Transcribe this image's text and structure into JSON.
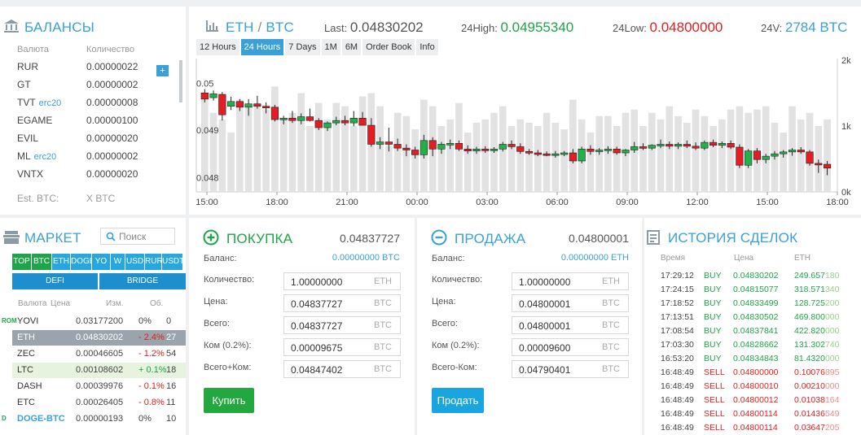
{
  "balances": {
    "title": "БАЛАНСЫ",
    "col_currency": "Валюта",
    "col_amount": "Количество",
    "add_label": "+",
    "rows": [
      {
        "cur": "RUR",
        "tag": "",
        "amt": "0.00000022"
      },
      {
        "cur": "GT",
        "tag": "",
        "amt": "0.00000002"
      },
      {
        "cur": "TVT",
        "tag": "erc20",
        "amt": "0.00000008"
      },
      {
        "cur": "EGAME",
        "tag": "",
        "amt": "0.00000100"
      },
      {
        "cur": "EVIL",
        "tag": "",
        "amt": "0.00000020"
      },
      {
        "cur": "ML",
        "tag": "erc20",
        "amt": "0.00000002"
      },
      {
        "cur": "VNTX",
        "tag": "",
        "amt": "0.00000020"
      }
    ],
    "est_label": "Est. BTC:",
    "est_value": "X BTC"
  },
  "pair": {
    "base": "ETH",
    "sep": " / ",
    "quote": "BTC",
    "last_label": "Last:",
    "last": "0.04830202",
    "high_label": "24High:",
    "high": "0.04955340",
    "low_label": "24Low:",
    "low": "0.04800000",
    "vol_label": "24V:",
    "vol": "2784 BTC"
  },
  "chart_tabs": [
    "12 Hours",
    "24 Hours",
    "7 Days",
    "1M",
    "6M",
    "Order Book",
    "Info"
  ],
  "chart_tab_active": 1,
  "colors": {
    "accent": "#3aa0d8",
    "up": "#1fa44a",
    "down": "#e02020",
    "candle_up": "#22b04b",
    "candle_down": "#e41c24"
  },
  "chart_data": {
    "type": "candlestick",
    "y_ticks": [
      "0.05",
      "0.049",
      "0.048"
    ],
    "y2_ticks": [
      "2k",
      "1k",
      "0k"
    ],
    "x_ticks": [
      "15:00",
      "18:00",
      "21:00",
      "00:00",
      "03:00",
      "06:00",
      "09:00",
      "12:00",
      "15:00",
      "18:00"
    ],
    "ylim": [
      0.0478,
      0.0505
    ],
    "y2lim": [
      0,
      2000
    ],
    "ohlc": [
      [
        0.04988,
        0.04996,
        0.04968,
        0.04975
      ],
      [
        0.04978,
        0.04993,
        0.04972,
        0.04986
      ],
      [
        0.04985,
        0.0499,
        0.0493,
        0.04942
      ],
      [
        0.0496,
        0.0498,
        0.04952,
        0.0497
      ],
      [
        0.0497,
        0.04975,
        0.0495,
        0.04958
      ],
      [
        0.04958,
        0.04975,
        0.0494,
        0.04965
      ],
      [
        0.04965,
        0.04982,
        0.04955,
        0.0496
      ],
      [
        0.0496,
        0.04968,
        0.04945,
        0.04958
      ],
      [
        0.04958,
        0.04963,
        0.04928,
        0.04932
      ],
      [
        0.04932,
        0.0494,
        0.04922,
        0.04935
      ],
      [
        0.04935,
        0.0495,
        0.04925,
        0.0493
      ],
      [
        0.0493,
        0.04945,
        0.04922,
        0.04938
      ],
      [
        0.04938,
        0.04955,
        0.04928,
        0.0493
      ],
      [
        0.0493,
        0.04935,
        0.0491,
        0.04915
      ],
      [
        0.04915,
        0.04928,
        0.04908,
        0.04925
      ],
      [
        0.04925,
        0.04938,
        0.0492,
        0.0493
      ],
      [
        0.0493,
        0.0494,
        0.0492,
        0.04925
      ],
      [
        0.04925,
        0.0495,
        0.04918,
        0.04935
      ],
      [
        0.04935,
        0.04948,
        0.04925,
        0.0492
      ],
      [
        0.0492,
        0.04935,
        0.04875,
        0.0488
      ],
      [
        0.0488,
        0.04895,
        0.0487,
        0.04885
      ],
      [
        0.04885,
        0.04915,
        0.04865,
        0.0488
      ],
      [
        0.0488,
        0.04892,
        0.04866,
        0.04872
      ],
      [
        0.04872,
        0.0488,
        0.04855,
        0.04868
      ],
      [
        0.04868,
        0.04875,
        0.0485,
        0.04858
      ],
      [
        0.04858,
        0.049,
        0.0485,
        0.04888
      ],
      [
        0.04888,
        0.04895,
        0.04855,
        0.0487
      ],
      [
        0.0487,
        0.04885,
        0.0486,
        0.0488
      ],
      [
        0.0488,
        0.0489,
        0.0487,
        0.04882
      ],
      [
        0.04882,
        0.04888,
        0.04866,
        0.0487
      ],
      [
        0.0487,
        0.04878,
        0.0486,
        0.04866
      ],
      [
        0.04866,
        0.04875,
        0.0486,
        0.0487
      ],
      [
        0.0487,
        0.04876,
        0.04862,
        0.04868
      ],
      [
        0.04868,
        0.04874,
        0.04862,
        0.0487
      ],
      [
        0.0487,
        0.04885,
        0.04865,
        0.0488
      ],
      [
        0.0488,
        0.04888,
        0.0487,
        0.04875
      ],
      [
        0.04875,
        0.04882,
        0.0486,
        0.04865
      ],
      [
        0.04865,
        0.0487,
        0.04858,
        0.04862
      ],
      [
        0.04862,
        0.04868,
        0.04855,
        0.0486
      ],
      [
        0.0486,
        0.04865,
        0.04855,
        0.04858
      ],
      [
        0.04858,
        0.04866,
        0.04852,
        0.0486
      ],
      [
        0.0486,
        0.04866,
        0.04855,
        0.04862
      ],
      [
        0.04862,
        0.0487,
        0.0484,
        0.04845
      ],
      [
        0.04845,
        0.04875,
        0.0484,
        0.0487
      ],
      [
        0.0487,
        0.04878,
        0.04858,
        0.04865
      ],
      [
        0.04865,
        0.04872,
        0.04858,
        0.04868
      ],
      [
        0.04868,
        0.04876,
        0.0486,
        0.0487
      ],
      [
        0.0487,
        0.04875,
        0.04858,
        0.04862
      ],
      [
        0.04862,
        0.0487,
        0.04855,
        0.04868
      ],
      [
        0.04868,
        0.04885,
        0.04862,
        0.04875
      ],
      [
        0.04875,
        0.04882,
        0.04868,
        0.04872
      ],
      [
        0.04872,
        0.0488,
        0.04868,
        0.04878
      ],
      [
        0.04878,
        0.0489,
        0.04872,
        0.0488
      ],
      [
        0.0488,
        0.04886,
        0.0487,
        0.04876
      ],
      [
        0.04876,
        0.04884,
        0.0487,
        0.0488
      ],
      [
        0.0488,
        0.04888,
        0.04872,
        0.04876
      ],
      [
        0.04876,
        0.04884,
        0.04868,
        0.04872
      ],
      [
        0.04872,
        0.04888,
        0.04868,
        0.04884
      ],
      [
        0.04884,
        0.0489,
        0.04874,
        0.04878
      ],
      [
        0.04878,
        0.04886,
        0.04872,
        0.04882
      ],
      [
        0.04882,
        0.04888,
        0.0487,
        0.04874
      ],
      [
        0.04874,
        0.0488,
        0.0483,
        0.04836
      ],
      [
        0.04836,
        0.0487,
        0.0483,
        0.04866
      ],
      [
        0.04866,
        0.04872,
        0.0484,
        0.04848
      ],
      [
        0.04848,
        0.0486,
        0.0484,
        0.04855
      ],
      [
        0.04855,
        0.04866,
        0.04848,
        0.0486
      ],
      [
        0.0486,
        0.04868,
        0.04852,
        0.04864
      ],
      [
        0.04864,
        0.04872,
        0.04856,
        0.04868
      ],
      [
        0.04868,
        0.04874,
        0.0486,
        0.04864
      ],
      [
        0.04864,
        0.04868,
        0.04835,
        0.0484
      ],
      [
        0.0484,
        0.04848,
        0.0482,
        0.04838
      ],
      [
        0.04838,
        0.04845,
        0.04815,
        0.0483
      ]
    ],
    "volume": [
      1500,
      1200,
      1100,
      900,
      1400,
      1300,
      1350,
      1250,
      1600,
      1100,
      1200,
      1500,
      1000,
      1350,
      1100,
      1350,
      1300,
      1000,
      1450,
      1500,
      1300,
      700,
      1200,
      1150,
      950,
      1400,
      1300,
      1000,
      1100,
      1350,
      900,
      1050,
      1100,
      1200,
      1300,
      1000,
      1100,
      1050,
      1000,
      1200,
      1050,
      950,
      1400,
      1100,
      900,
      1150,
      1150,
      1000,
      1200,
      1250,
      1000,
      1200,
      1100,
      1300,
      1150,
      1050,
      1250,
      1150,
      1000,
      1100,
      1250,
      1300,
      1200,
      1250,
      1300,
      1050,
      900,
      1300,
      1100,
      1200,
      1000,
      1100
    ]
  },
  "buy": {
    "title": "ПОКУПКА",
    "price": "0.04837727",
    "balance_label": "Баланс:",
    "balance": "0.00000000 BTC",
    "fields": [
      {
        "label": "Количество:",
        "value": "1.00000000",
        "unit": "ETH"
      },
      {
        "label": "Цена:",
        "value": "0.04837727",
        "unit": "BTC"
      },
      {
        "label": "Всего:",
        "value": "0.04837727",
        "unit": "BTC"
      },
      {
        "label": "Ком (0.2%):",
        "value": "0.00009675",
        "unit": "BTC"
      },
      {
        "label": "Всего+Ком:",
        "value": "0.04847402",
        "unit": "BTC"
      }
    ],
    "button": "Купить"
  },
  "sell": {
    "title": "ПРОДАЖА",
    "price": "0.04800001",
    "balance_label": "Баланс:",
    "balance": "0.00000000 ETH",
    "fields": [
      {
        "label": "Количество:",
        "value": "1.00000000",
        "unit": "ETH"
      },
      {
        "label": "Цена:",
        "value": "0.04800001",
        "unit": "BTC"
      },
      {
        "label": "Всего:",
        "value": "0.04800001",
        "unit": "BTC"
      },
      {
        "label": "Ком (0.2%):",
        "value": "0.00009600",
        "unit": "BTC"
      },
      {
        "label": "Всего-Ком:",
        "value": "0.04790401",
        "unit": "BTC"
      }
    ],
    "button": "Продать"
  },
  "market": {
    "title": "МАРКЕТ",
    "search_placeholder": "Поиск",
    "tabs": [
      "TOP",
      "BTC",
      "ETH",
      "DOGE",
      "YO",
      "W",
      "USD",
      "RUR",
      "USDT"
    ],
    "subtabs": [
      "DEFI",
      "BRIDGE"
    ],
    "col_currency": "Валюта",
    "col_price": "Цена",
    "col_change": "Изм.",
    "col_vol": "Об.",
    "rows": [
      {
        "badge": "ROM",
        "name": "YOVI",
        "price": "0.03177200",
        "chg": "0%",
        "vol": "0",
        "state": "none",
        "chg_dir": "flat"
      },
      {
        "badge": "",
        "name": "ETH",
        "price": "0.04830202",
        "chg": "- 2.4%",
        "vol": "27",
        "state": "selected",
        "chg_dir": "down"
      },
      {
        "badge": "",
        "name": "ZEC",
        "price": "0.00046605",
        "chg": "- 1.2%",
        "vol": "54",
        "state": "none",
        "chg_dir": "down"
      },
      {
        "badge": "",
        "name": "LTC",
        "price": "0.00108602",
        "chg": "+ 0.1%",
        "vol": "18",
        "state": "highlight",
        "chg_dir": "up"
      },
      {
        "badge": "",
        "name": "DASH",
        "price": "0.00039976",
        "chg": "- 0.1%",
        "vol": "16",
        "state": "none",
        "chg_dir": "down"
      },
      {
        "badge": "",
        "name": "ETC",
        "price": "0.00026405",
        "chg": "- 0.8%",
        "vol": "11",
        "state": "none",
        "chg_dir": "down"
      },
      {
        "badge": "D",
        "name": "DOGE-BTC",
        "price": "0.00000193",
        "chg": "0%",
        "vol": "10",
        "state": "none",
        "chg_dir": "flat"
      }
    ]
  },
  "history": {
    "title": "ИСТОРИЯ СДЕЛОК",
    "col_time": "Время",
    "col_price": "Цена",
    "col_amt": "ETH",
    "rows": [
      {
        "time": "17:29:12",
        "side": "BUY",
        "price": "0.04830202",
        "amt_main": "249.657",
        "amt_tail": "180"
      },
      {
        "time": "17:24:15",
        "side": "BUY",
        "price": "0.04815077",
        "amt_main": "318.571",
        "amt_tail": "340"
      },
      {
        "time": "17:18:52",
        "side": "BUY",
        "price": "0.04833499",
        "amt_main": "128.725",
        "amt_tail": "200"
      },
      {
        "time": "17:13:51",
        "side": "BUY",
        "price": "0.04830502",
        "amt_main": "469.800",
        "amt_tail": "000"
      },
      {
        "time": "17:08:54",
        "side": "BUY",
        "price": "0.04837841",
        "amt_main": "422.820",
        "amt_tail": "000"
      },
      {
        "time": "17:03:30",
        "side": "BUY",
        "price": "0.04828662",
        "amt_main": "131.302",
        "amt_tail": "740"
      },
      {
        "time": "16:53:20",
        "side": "BUY",
        "price": "0.04834843",
        "amt_main": "81.4320",
        "amt_tail": "000"
      },
      {
        "time": "16:48:49",
        "side": "SELL",
        "price": "0.04800000",
        "amt_main": "0.10076",
        "amt_tail": "895"
      },
      {
        "time": "16:48:49",
        "side": "SELL",
        "price": "0.04800010",
        "amt_main": "0.00210",
        "amt_tail": "000"
      },
      {
        "time": "16:48:49",
        "side": "SELL",
        "price": "0.04800012",
        "amt_main": "0.01038",
        "amt_tail": "164"
      },
      {
        "time": "16:48:49",
        "side": "SELL",
        "price": "0.04800114",
        "amt_main": "0.01436",
        "amt_tail": "549"
      },
      {
        "time": "16:48:49",
        "side": "SELL",
        "price": "0.04800114",
        "amt_main": "0.03647",
        "amt_tail": "205"
      }
    ]
  }
}
